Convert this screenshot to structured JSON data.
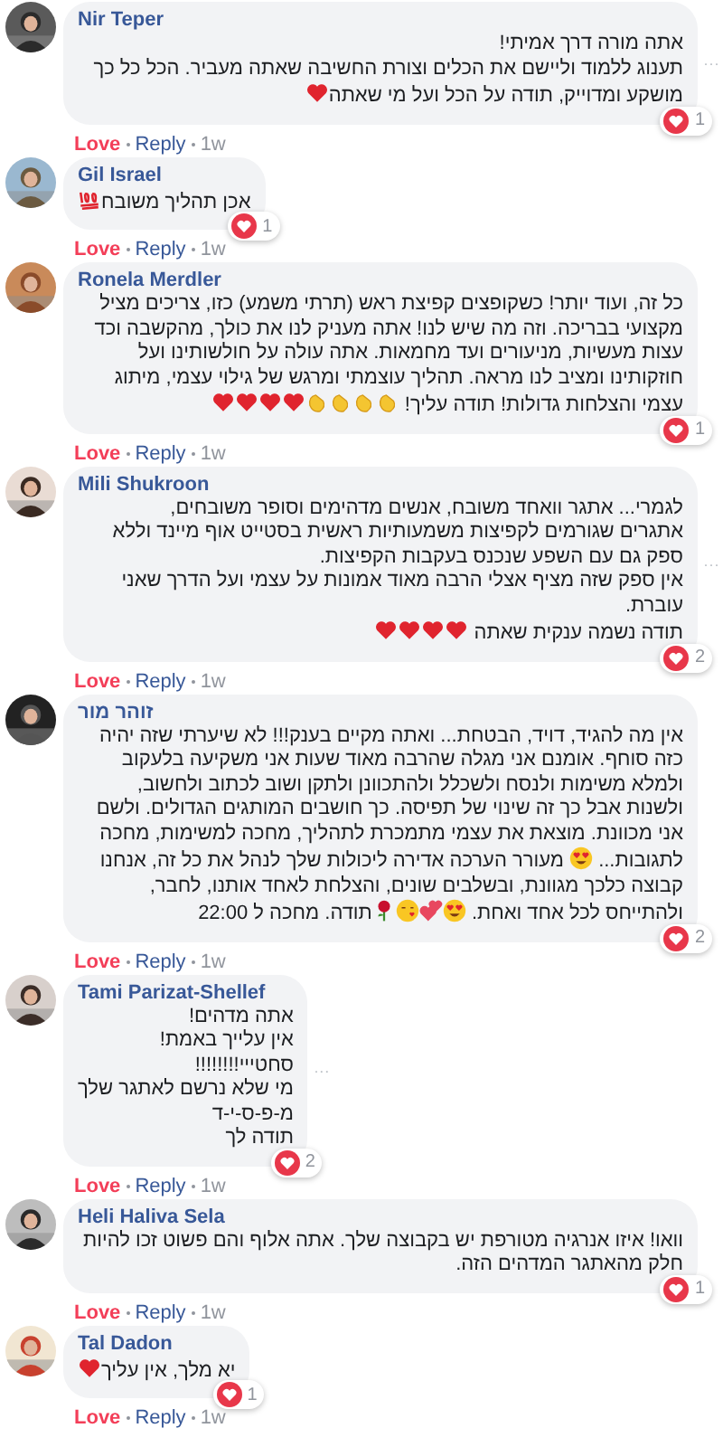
{
  "comments": [
    {
      "author": "Nir Teper",
      "more": "···",
      "body": [
        [
          {
            "kind": "text",
            "text": "אתה מורה דרך אמיתי!"
          }
        ],
        [
          {
            "kind": "text",
            "text": "תענוג ללמוד וליישם את הכלים וצורת החשיבה שאתה מעביר. הכל כל כך מושקע ומדוייק, תודה על הכל ועל מי שאתה"
          },
          {
            "kind": "heart"
          }
        ]
      ],
      "reactions": "1",
      "love": "Love",
      "loved": true,
      "reply": "Reply",
      "time": "1w"
    },
    {
      "author": "Gil Israel",
      "body": [
        [
          {
            "kind": "text",
            "text": "אכן תהליך משובח"
          },
          {
            "kind": "hundred"
          }
        ]
      ],
      "reactions": "1",
      "love": "Love",
      "loved": true,
      "reply": "Reply",
      "time": "1w"
    },
    {
      "author": "Ronela Merdler",
      "body": [
        [
          {
            "kind": "text",
            "text": "כל זה, ועוד יותר! כשקופצים קפיצת ראש (תרתי משמע) כזו, צריכים מציל מקצועי בבריכה. וזה מה שיש לנו! אתה מעניק לנו את כולך, מהקשבה וכד עצות מעשיות, מניעורים ועד מחמאות. אתה עולה על חולשותינו ועל חוזקותינו ומציב לנו מראה. תהליך עוצמתי ומרגש של גילוי עצמי, מיתוג עצמי והצלחות גדולות! תודה עליך! "
          },
          {
            "kind": "clap"
          },
          {
            "kind": "clap"
          },
          {
            "kind": "clap"
          },
          {
            "kind": "clap"
          },
          {
            "kind": "heart"
          },
          {
            "kind": "heart"
          },
          {
            "kind": "heart"
          },
          {
            "kind": "heart"
          }
        ]
      ],
      "reactions": "1",
      "love": "Love",
      "loved": true,
      "reply": "Reply",
      "time": "1w"
    },
    {
      "author": "Mili Shukroon",
      "more": "···",
      "body": [
        [
          {
            "kind": "text",
            "text": "לגמרי... אתגר וואחד משובח, אנשים מדהימים וסופר משובחים,"
          }
        ],
        [
          {
            "kind": "text",
            "text": "אתגרים שגורמים לקפיצות משמעותיות ראשית בסטייט אוף מיינד וללא ספק גם עם השפע שנכנס בעקבות הקפיצות."
          }
        ],
        [
          {
            "kind": "text",
            "text": "אין ספק שזה מציף אצלי הרבה מאוד אמונות על עצמי ועל הדרך שאני עוברת."
          }
        ],
        [
          {
            "kind": "text",
            "text": "תודה נשמה ענקית שאתה "
          },
          {
            "kind": "heart"
          },
          {
            "kind": "heart"
          },
          {
            "kind": "heart"
          },
          {
            "kind": "heart"
          }
        ]
      ],
      "reactions": "2",
      "love": "Love",
      "loved": true,
      "reply": "Reply",
      "time": "1w"
    },
    {
      "author": "זוהר מור",
      "body": [
        [
          {
            "kind": "text",
            "text": "אין מה להגיד, דויד, הבטחת... ואתה מקיים בענק!!! לא שיערתי שזה יהיה כזה סוחף. אומנם אני מגלה שהרבה מאוד שעות אני משקיעה בלעקוב ולמלא משימות ולנסח ולשכלל ולהתכוונן ולתקן ושוב לכתוב ולחשוב, ולשנות אבל כך זה שינוי של תפיסה. כך חושבים המותגים הגדולים. ולשם אני מכוונת. מוצאת את עצמי מתמכרת לתהליך, מחכה למשימות, מחכה לתגובות... "
          },
          {
            "kind": "heart-eyes"
          },
          {
            "kind": "text",
            "text": " מעורר הערכה אדירה ליכולות שלך לנהל את כל זה, אנחנו קבוצה כלכך מגוונת, ובשלבים שונים, והצלחת לאחד אותנו, לחבר, ולהתייחס לכל אחד ואחת. "
          },
          {
            "kind": "heart-eyes"
          },
          {
            "kind": "two-hearts"
          },
          {
            "kind": "kiss"
          },
          {
            "kind": "rose"
          },
          {
            "kind": "text",
            "text": "תודה. מחכה ל 22:00"
          }
        ]
      ],
      "reactions": "2",
      "love": "Love",
      "loved": true,
      "reply": "Reply",
      "time": "1w"
    },
    {
      "author": "Tami Parizat-Shellef",
      "more": "···",
      "body": [
        [
          {
            "kind": "text",
            "text": "אתה מדהים!"
          }
        ],
        [
          {
            "kind": "text",
            "text": "אין עלייך באמת!"
          }
        ],
        [
          {
            "kind": "text",
            "text": "סחטייי!!!!!!!!"
          }
        ],
        [
          {
            "kind": "text",
            "text": "מי שלא נרשם לאתגר שלך"
          }
        ],
        [
          {
            "kind": "text",
            "text": "מ-פ-ס-י-ד"
          }
        ],
        [
          {
            "kind": "text",
            "text": "תודה לך"
          }
        ]
      ],
      "reactions": "2",
      "love": "Love",
      "loved": true,
      "reply": "Reply",
      "time": "1w"
    },
    {
      "author": "Heli Haliva Sela",
      "body": [
        [
          {
            "kind": "text",
            "text": "וואו! איזו אנרגיה מטורפת יש בקבוצה שלך. אתה אלוף והם פשוט זכו להיות חלק מהאתגר המדהים הזה."
          }
        ]
      ],
      "reactions": "1",
      "love": "Love",
      "loved": true,
      "reply": "Reply",
      "time": "1w"
    },
    {
      "author": "Tal Dadon",
      "body": [
        [
          {
            "kind": "text",
            "text": "יא מלך, אין עליך"
          },
          {
            "kind": "heart"
          }
        ]
      ],
      "reactions": "1",
      "love": "Love",
      "loved": true,
      "reply": "Reply",
      "time": "1w"
    }
  ]
}
